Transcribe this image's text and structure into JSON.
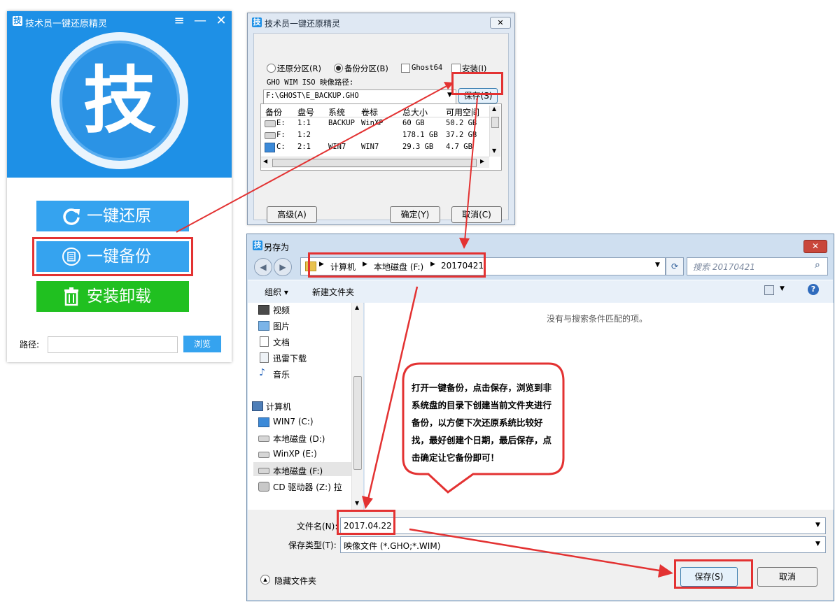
{
  "launcher": {
    "title": "技术员一键还原精灵",
    "app_icon": "技",
    "logo_char": "技",
    "menu_icon": "≡",
    "min_icon": "—",
    "close_icon": "✕",
    "restore_label": "一键还原",
    "backup_label": "一键备份",
    "install_label": "安装卸载",
    "path_label": "路径:",
    "path_value": "",
    "browse_label": "浏览",
    "colors": {
      "accent": "#1e90e6",
      "button_blue": "#35a3ef",
      "install_green": "#20c020"
    }
  },
  "dialog": {
    "title": "技术员一键还原精灵",
    "close_icon": "✕",
    "radio_restore": "还原分区(R)",
    "radio_backup": "备份分区(B)",
    "radio_selected": "备份分区(B)",
    "check_ghost64": "Ghost64",
    "check_install": "安装(I)",
    "path_caption": "GHO WIM ISO 映像路径:",
    "path_value": "F:\\GHOST\\E_BACKUP.GHO",
    "save_label": "保存(S)",
    "table_headers": [
      "备份",
      "盘号",
      "系统",
      "卷标",
      "总大小",
      "可用空间"
    ],
    "table_rows": [
      {
        "drive": "E:",
        "disk": "1:1",
        "sys": "BACKUP",
        "label": "WinXP",
        "total": "60 GB",
        "free": "50.2 GB"
      },
      {
        "drive": "F:",
        "disk": "1:2",
        "sys": "",
        "label": "",
        "total": "178.1 GB",
        "free": "37.2 GB"
      },
      {
        "drive": "C:",
        "disk": "2:1",
        "sys": "WIN7",
        "label": "WIN7",
        "total": "29.3 GB",
        "free": "4.7 GB"
      }
    ],
    "advanced_label": "高级(A)",
    "ok_label": "确定(Y)",
    "cancel_label": "取消(C)"
  },
  "saveas": {
    "title": "另存为",
    "close_icon": "✕",
    "breadcrumb": [
      "计算机",
      "本地磁盘 (F:)",
      "20170421"
    ],
    "search_placeholder": "搜索 20170421",
    "organize_label": "组织 ▾",
    "new_folder_label": "新建文件夹",
    "empty_message": "没有与搜索条件匹配的项。",
    "nav_items": [
      {
        "label": "视频",
        "icon": "video-icon"
      },
      {
        "label": "图片",
        "icon": "picture-icon"
      },
      {
        "label": "文档",
        "icon": "document-icon"
      },
      {
        "label": "迅雷下载",
        "icon": "download-icon"
      },
      {
        "label": "音乐",
        "icon": "music-icon"
      },
      {
        "label": "计算机",
        "icon": "computer-icon"
      },
      {
        "label": "WIN7 (C:)",
        "icon": "system-drive-icon"
      },
      {
        "label": "本地磁盘 (D:)",
        "icon": "drive-icon"
      },
      {
        "label": "WinXP (E:)",
        "icon": "drive-icon"
      },
      {
        "label": "本地磁盘 (F:)",
        "icon": "drive-icon"
      },
      {
        "label": "CD 驱动器 (Z:) 拉",
        "icon": "cd-drive-icon"
      }
    ],
    "filename_label": "文件名(N):",
    "filename_value": "2017.04.22",
    "filetype_label": "保存类型(T):",
    "filetype_value": "映像文件 (*.GHO;*.WIM)",
    "hide_folders_label": "隐藏文件夹",
    "save_label": "保存(S)",
    "cancel_label": "取消"
  },
  "callout": {
    "lines": [
      "打开一键备份，点击保存，浏览到非",
      "系统盘的目录下创建当前文件夹进行",
      "备份，以方便下次还原系统比较好",
      "找，最好创建个日期，最后保存，点",
      "击确定让它备份即可！"
    ]
  },
  "annotation_color": "#e33232"
}
